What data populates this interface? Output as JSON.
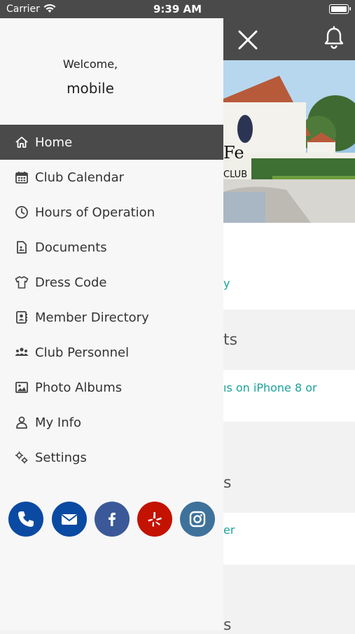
{
  "status_bar": {
    "carrier": "Carrier",
    "time": "9:39 AM"
  },
  "drawer": {
    "welcome": "Welcome,",
    "username": "mobile",
    "menu": [
      {
        "label": "Home",
        "icon": "home-icon",
        "active": true
      },
      {
        "label": "Club Calendar",
        "icon": "calendar-icon"
      },
      {
        "label": "Hours of Operation",
        "icon": "clock-icon"
      },
      {
        "label": "Documents",
        "icon": "document-icon"
      },
      {
        "label": "Dress Code",
        "icon": "shirt-icon"
      },
      {
        "label": "Member Directory",
        "icon": "contact-book-icon"
      },
      {
        "label": "Club Personnel",
        "icon": "people-icon"
      },
      {
        "label": "Photo Albums",
        "icon": "image-icon"
      },
      {
        "label": "My Info",
        "icon": "person-icon"
      },
      {
        "label": "Settings",
        "icon": "gears-icon"
      }
    ],
    "social": [
      {
        "name": "phone-icon",
        "color": "#0b4aa2"
      },
      {
        "name": "email-icon",
        "color": "#0b4aa2"
      },
      {
        "name": "facebook-icon",
        "color": "#3b5998"
      },
      {
        "name": "yelp-icon",
        "color": "#c41200"
      },
      {
        "name": "instagram-icon",
        "color": "#3f729b"
      }
    ]
  },
  "background": {
    "hero_text": "Fe",
    "hero_text2": "CLUB",
    "card1_link": "y",
    "section1": "ts",
    "card2_link": "ıs on iPhone 8 or",
    "section2": "s",
    "card3_link": "er",
    "section3": "s"
  },
  "colors": {
    "header": "#4a4a4a",
    "accent": "#1aa39a"
  }
}
